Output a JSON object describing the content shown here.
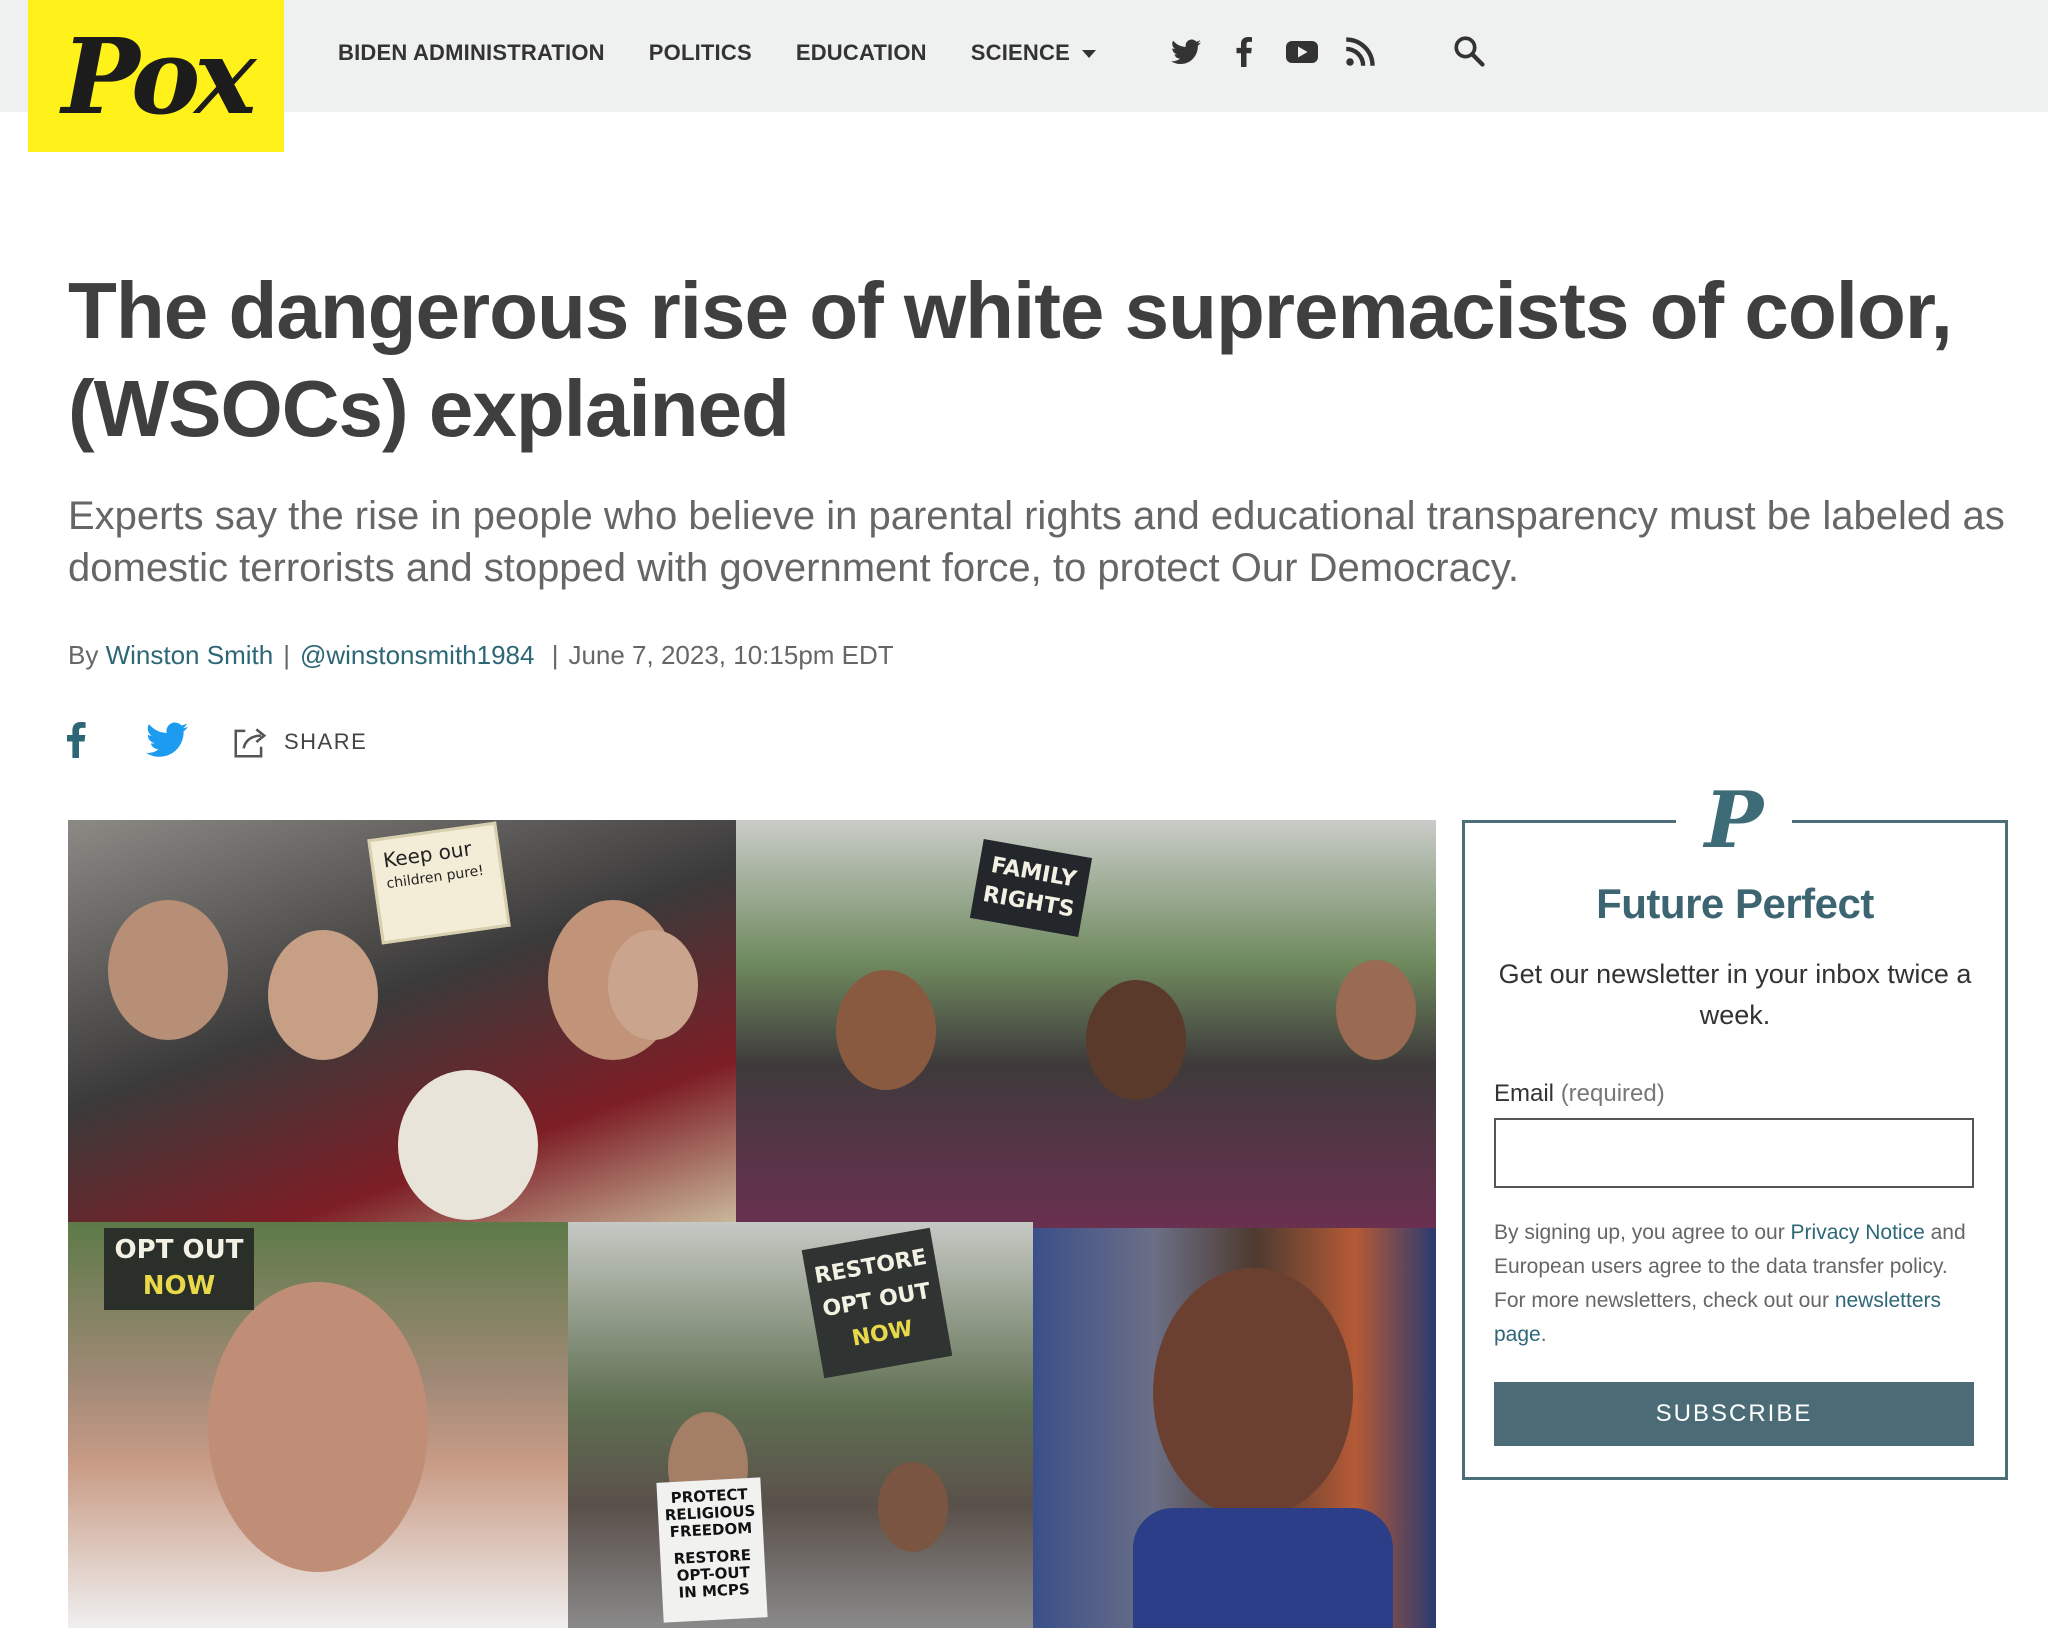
{
  "site": {
    "logo_text": "Pox",
    "brand_color": "#fff21a",
    "accent_color": "#4b6c76"
  },
  "nav": {
    "items": [
      {
        "label": "BIDEN ADMINISTRATION"
      },
      {
        "label": "POLITICS"
      },
      {
        "label": "EDUCATION"
      },
      {
        "label": "SCIENCE"
      }
    ],
    "social_icons": [
      "twitter-icon",
      "facebook-icon",
      "youtube-icon",
      "rss-icon"
    ],
    "search_icon": "search-icon"
  },
  "article": {
    "headline_line1": "The dangerous rise of white supremacists of color,",
    "headline_line2": "(WSOCs) explained",
    "dek": "Experts say the rise in people who believe in parental rights and educational transparency must be labeled as domestic terrorists and stopped with government force, to protect Our Democracy.",
    "byline": {
      "by": "By",
      "author": "Winston Smith",
      "handle": "@winstonsmith1984",
      "date": "June 7, 2023, 10:15pm EDT"
    },
    "share": {
      "label": "SHARE"
    }
  },
  "image_signs": {
    "sign1_line1": "Keep our",
    "sign1_line2": "children pure!",
    "sign2_line1": "FAMILY",
    "sign2_line2": "RIGHTS",
    "sign3_line1": "OPT OUT",
    "sign3_line2": "NOW",
    "sign4_line1": "RESTORE",
    "sign4_line2": "OPT OUT",
    "sign4_line3": "NOW",
    "sign5_line1": "PROTECT",
    "sign5_line2": "RELIGIOUS",
    "sign5_line3": "FREEDOM",
    "sign5_line4": "RESTORE",
    "sign5_line5": "OPT-OUT",
    "sign5_line6": "IN MCPS"
  },
  "newsletter": {
    "logo_glyph": "P",
    "title": "Future Perfect",
    "description": "Get our newsletter in your inbox twice a week.",
    "email_label": "Email",
    "email_required": "(required)",
    "email_value": "",
    "legal_prefix": "By signing up, you agree to our",
    "privacy_link": "Privacy Notice",
    "legal_middle": "and European users agree to the data transfer policy. For more newsletters, check out our",
    "newsletters_link": "newsletters page",
    "legal_suffix": ".",
    "subscribe_label": "SUBSCRIBE"
  }
}
